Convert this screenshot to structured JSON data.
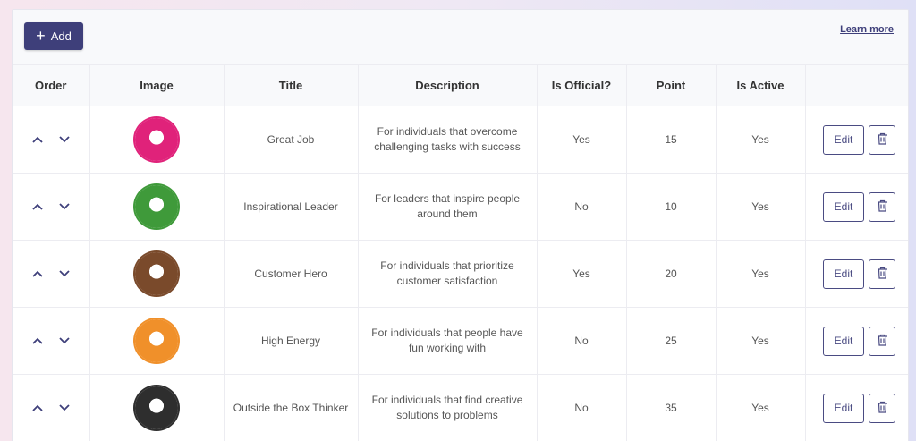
{
  "toolbar": {
    "add_label": "Add",
    "learn_more": "Learn more"
  },
  "table": {
    "headers": [
      "Order",
      "Image",
      "Title",
      "Description",
      "Is Official?",
      "Point",
      "Is Active",
      ""
    ],
    "edit_label": "Edit",
    "rows": [
      {
        "title": "Great Job",
        "description": "For individuals that overcome challenging tasks with success",
        "official": "Yes",
        "point": "15",
        "active": "Yes",
        "image": "thumbs-up-badge",
        "color": "#e0227a"
      },
      {
        "title": "Inspirational Leader",
        "description": "For leaders that inspire people around them",
        "official": "No",
        "point": "10",
        "active": "Yes",
        "image": "team-leader-badge",
        "color": "#3f9a3a"
      },
      {
        "title": "Customer Hero",
        "description": "For individuals that prioritize customer satisfaction",
        "official": "Yes",
        "point": "20",
        "active": "Yes",
        "image": "hero-badge",
        "color": "#7a4a2b"
      },
      {
        "title": "High Energy",
        "description": "For individuals that people have fun working with",
        "official": "No",
        "point": "25",
        "active": "Yes",
        "image": "energy-badge",
        "color": "#f0902a"
      },
      {
        "title": "Outside the Box Thinker",
        "description": "For individuals that find creative solutions to problems",
        "official": "No",
        "point": "35",
        "active": "Yes",
        "image": "thinker-badge",
        "color": "#2e2e2e"
      }
    ]
  }
}
